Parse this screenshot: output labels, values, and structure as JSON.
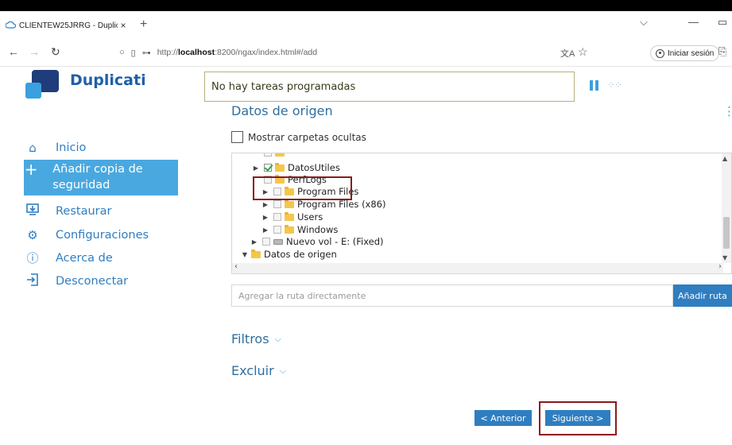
{
  "browser": {
    "tab_title": "CLIENTEW25JRRG - Duplicati",
    "tab_close": "×",
    "new_tab": "+",
    "url_prefix": "http://",
    "url_host": "localhost",
    "url_rest": ":8200/ngax/index.html#/add",
    "signin_label": "Iniciar sesión"
  },
  "app": {
    "brand": "Duplicati",
    "status_message": "No hay tareas programadas"
  },
  "sidebar": {
    "items": [
      {
        "label": "Inicio",
        "icon": "home-icon"
      },
      {
        "label": "Añadir copia de seguridad",
        "icon": "plus-icon"
      },
      {
        "label": "Restaurar",
        "icon": "restore-icon"
      },
      {
        "label": "Configuraciones",
        "icon": "gear-icon"
      },
      {
        "label": "Acerca de",
        "icon": "info-icon"
      },
      {
        "label": "Desconectar",
        "icon": "logout-icon"
      }
    ],
    "active_index": 1
  },
  "main": {
    "section_title": "Datos de origen",
    "show_hidden_label": "Mostrar carpetas ocultas",
    "tree": [
      {
        "label": "DatosUtiles",
        "checked": true,
        "expander": "▶",
        "icon": "folder"
      },
      {
        "label": "PerfLogs",
        "checked": false,
        "expander": "",
        "icon": "folder"
      },
      {
        "label": "Program Files",
        "checked": false,
        "expander": "▶",
        "icon": "folder"
      },
      {
        "label": "Program Files (x86)",
        "checked": false,
        "expander": "▶",
        "icon": "folder"
      },
      {
        "label": "Users",
        "checked": false,
        "expander": "▶",
        "icon": "folder"
      },
      {
        "label": "Windows",
        "checked": false,
        "expander": "▶",
        "icon": "folder"
      },
      {
        "label": "Nuevo vol - E: (Fixed)",
        "checked": false,
        "expander": "▶",
        "icon": "drive"
      },
      {
        "label": "Datos de origen",
        "checked": null,
        "expander": "▼",
        "icon": "folder"
      }
    ],
    "path_placeholder": "Agregar la ruta directamente",
    "add_path_label": "Añadir ruta",
    "filters_label": "Filtros",
    "exclude_label": "Excluir",
    "prev_label": "< Anterior",
    "next_label": "Siguiente >"
  },
  "colors": {
    "accent": "#2f7ec1",
    "sidebar_active": "#4aa8e0",
    "highlight_border": "#8b1a1a",
    "brand": "#1f5fa8"
  }
}
